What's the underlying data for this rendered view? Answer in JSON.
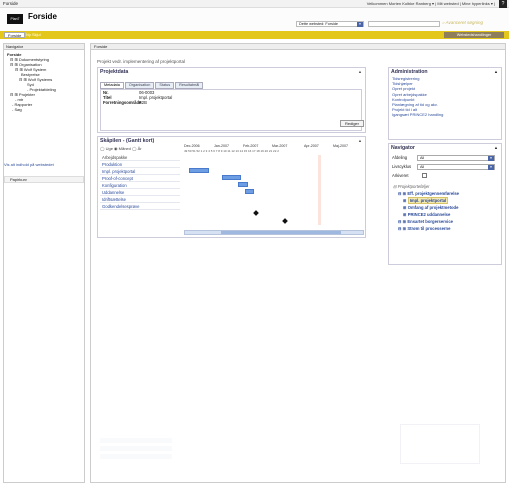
{
  "topbar": {
    "title": "Forside",
    "welcome": "Velkommen Morten Kolbke Ranberg ▾ | Mit websted | Mine hyperlinks ▾ |",
    "help": "?"
  },
  "header": {
    "logo": "Plan7",
    "title": "Forside",
    "scope": "Dette websted: Forside",
    "search_label": "Avanceret søgning"
  },
  "tabs": {
    "active": "Forside",
    "other": "Ny Skjul",
    "right": "Webstedshandlinger"
  },
  "left": {
    "header": "Navigator",
    "tree": [
      "Forside",
      "⊟ ⊞ Dokumentstyring",
      "⊟ ⊞ Organisation",
      "⊟ ⊞ Wolf System",
      "Bestyrelse",
      "⊟ ⊞ Wolf Systems",
      "Syd",
      "- Projektafdeling",
      "⊟ ⊞ Projekter",
      "- mtr",
      "- Rapporter",
      "- Søg"
    ],
    "link": "Vis alt indhold på webstedet",
    "bottom": "Papirkurv"
  },
  "main": {
    "header": "Forside",
    "crumb": "Projekt vedr. implementering af projektportal"
  },
  "projektdata": {
    "title": "Projektdata",
    "tabs": [
      "Metadata",
      "Organisation",
      "Status",
      "Resultatmål"
    ],
    "fields": [
      {
        "k": "Nr.",
        "v": "06-0003"
      },
      {
        "k": "Titel",
        "v": "Impl. projektportal"
      },
      {
        "k": "Forretningsområde",
        "v": "B2B"
      }
    ],
    "button": "Rediger"
  },
  "gantt": {
    "title": "Skåpilen - (Gantt kort)",
    "options": "◯ Uge  ◉ Måned  ◯ År",
    "months": [
      "Dec-2006",
      "Jan-2007",
      "Feb-2007",
      "Mar-2007",
      "Apr-2007",
      "Maj-2007"
    ],
    "numbers": "49 50 51 52 1  2  3  4  5  6  7  8  9  10 11 12 13 14 15 16 17 18 19 20 21 22 2",
    "rows": [
      "Arbejdspakke",
      "Produktion",
      "Impl. projektportal",
      "Proof-of-concept",
      "Konfiguration",
      "Uddannelse",
      "Idriftsættelse",
      "Godkendelsesprøve"
    ]
  },
  "admin": {
    "title": "Administration",
    "links": [
      "Tidsregistrering",
      "Tidshjælper",
      "Opret projekt",
      "Opret arbejdspakke",
      "Kontrolpunkt",
      "Planlægning af tid og akv.",
      "Projekt tid i alt",
      "Igangsæt PRINCE2 handling"
    ]
  },
  "navigator": {
    "title": "Navigator",
    "afdeling_label": "Afdeling",
    "afdeling": "All",
    "livscyklus_label": "Livscyklus",
    "livscyklus": "All",
    "arkiveret_label": "Arkiveret",
    "tree_root": "Projektporteføljer",
    "tree": [
      "Eff. projektgennemførelse",
      "Impl. projektportal",
      "Omfang af projektmetode",
      "PRINCE2 uddannelse",
      "Ensartet borgerservice",
      "Strøm til processerne"
    ]
  }
}
